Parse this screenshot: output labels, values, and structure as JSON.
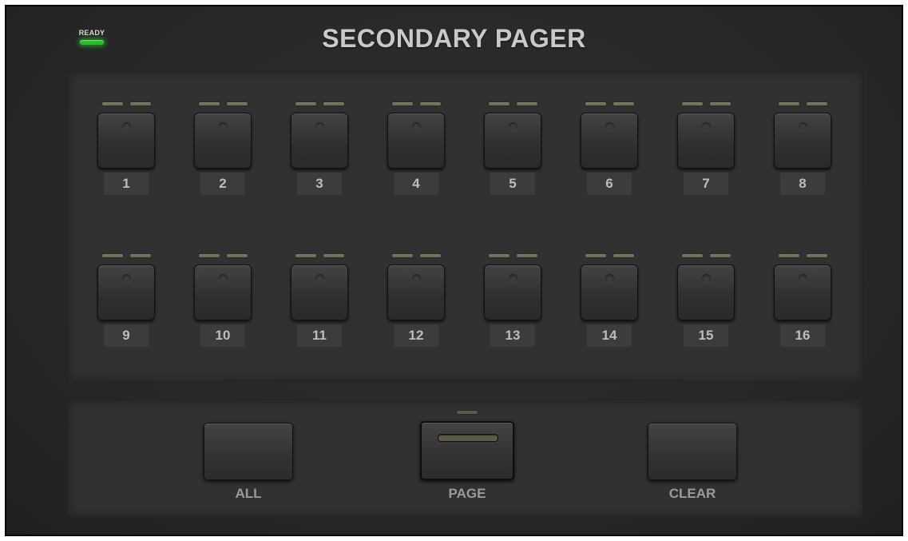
{
  "status": {
    "ready_label": "READY"
  },
  "header": {
    "title": "SECONDARY PAGER"
  },
  "channels": [
    {
      "label": "1"
    },
    {
      "label": "2"
    },
    {
      "label": "3"
    },
    {
      "label": "4"
    },
    {
      "label": "5"
    },
    {
      "label": "6"
    },
    {
      "label": "7"
    },
    {
      "label": "8"
    },
    {
      "label": "9"
    },
    {
      "label": "10"
    },
    {
      "label": "11"
    },
    {
      "label": "12"
    },
    {
      "label": "13"
    },
    {
      "label": "14"
    },
    {
      "label": "15"
    },
    {
      "label": "16"
    }
  ],
  "controls": {
    "all_label": "ALL",
    "page_label": "PAGE",
    "clear_label": "CLEAR"
  },
  "colors": {
    "ready_led": "#25c025",
    "indicator_led_off": "#6f6f58",
    "background": "#2a2a2a"
  }
}
